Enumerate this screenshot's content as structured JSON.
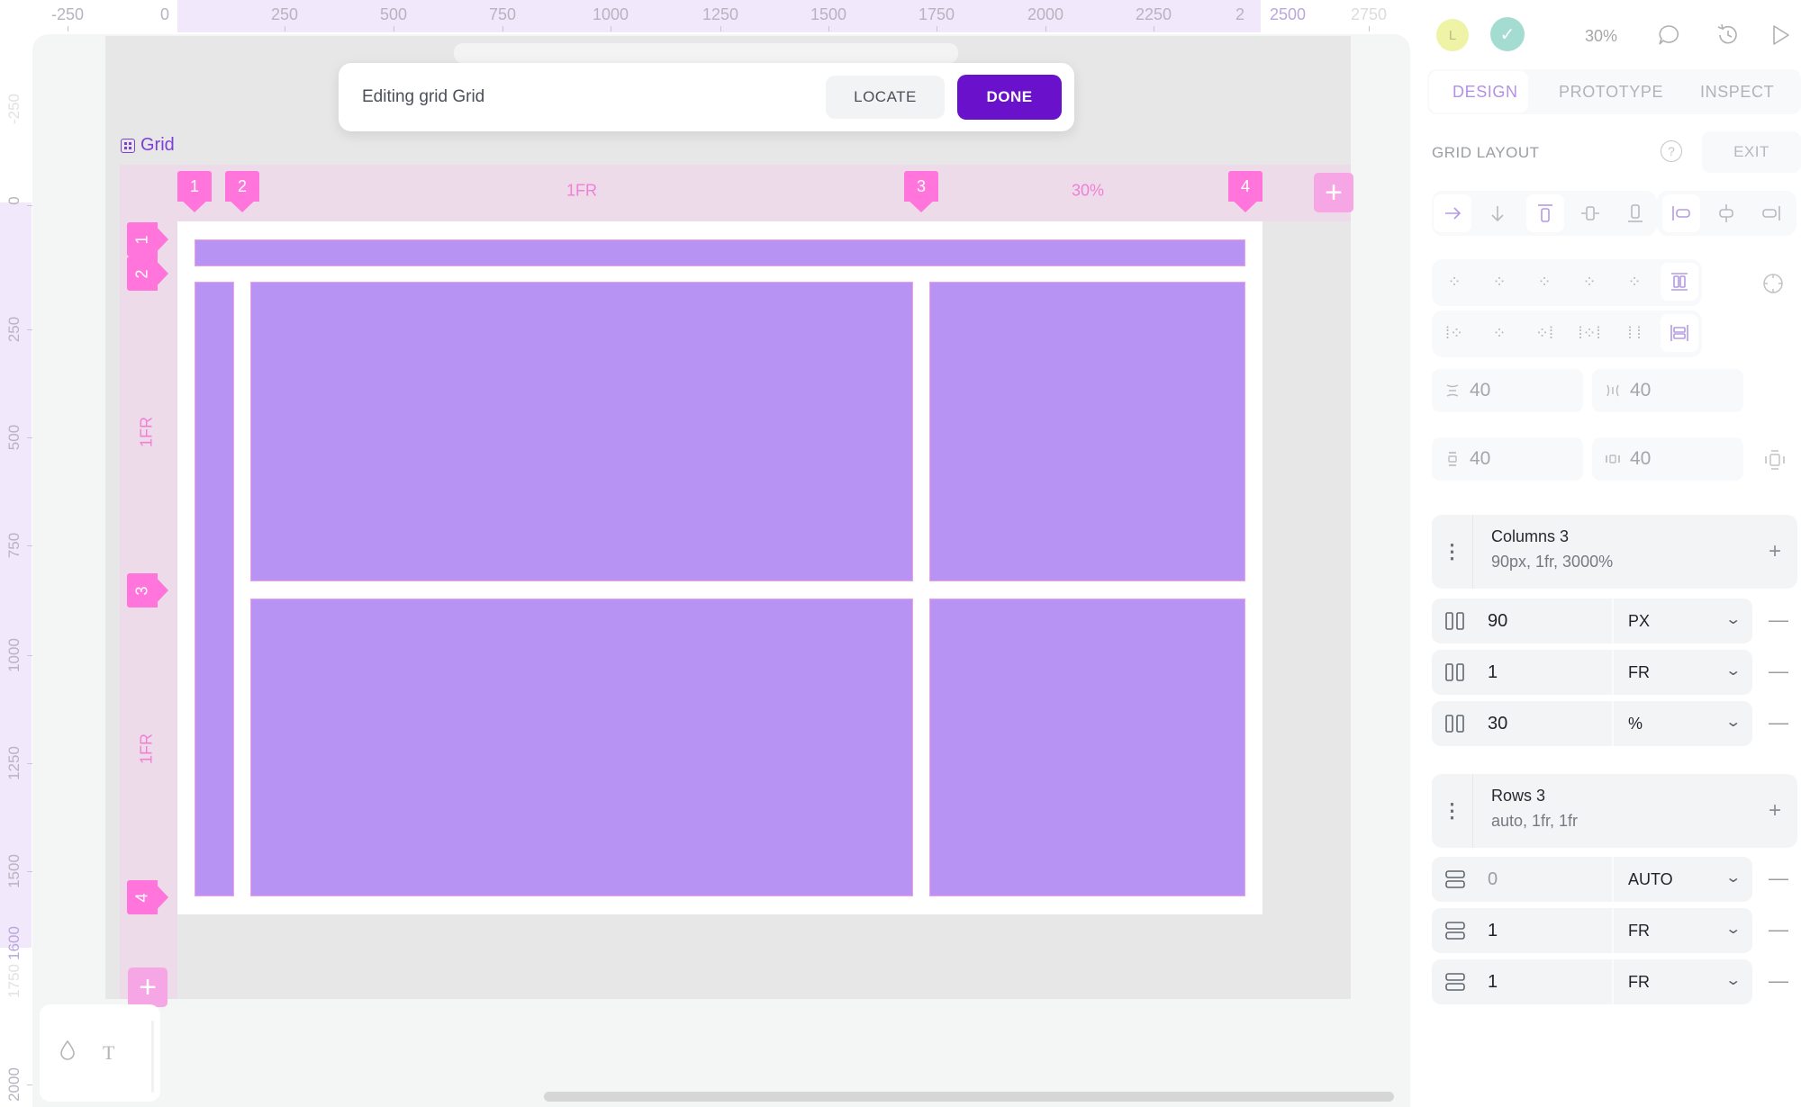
{
  "ruler_top": {
    "labels": [
      "-250",
      "0",
      "250",
      "500",
      "750",
      "1000",
      "1250",
      "1500",
      "1750",
      "2000",
      "2250",
      "2",
      "2500",
      "2750"
    ]
  },
  "ruler_left": {
    "labels": [
      "-250",
      "0",
      "250",
      "500",
      "750",
      "1000",
      "1250",
      "1500",
      "1600",
      "1750",
      "2000"
    ]
  },
  "edit_toolbar": {
    "title": "Editing grid Grid",
    "locate_label": "LOCATE",
    "done_label": "DONE"
  },
  "canvas": {
    "board_name": "Grid",
    "column_markers": [
      "1",
      "2",
      "3",
      "4"
    ],
    "row_markers": [
      "1",
      "2",
      "3",
      "4"
    ],
    "column_sizes": [
      "1FR",
      "30%"
    ],
    "row_sizes": [
      "1FR",
      "1FR"
    ],
    "add_column_icon": "plus-icon",
    "add_row_icon": "plus-icon",
    "cell_color": "#b794f4",
    "marker_color": "#ff75dc"
  },
  "tools": {
    "fill_icon": "drop-icon",
    "text_icon": "T"
  },
  "header": {
    "avatar_initial": "L",
    "status_icon": "check-icon",
    "zoom": "30%"
  },
  "tabs": [
    {
      "label": "DESIGN",
      "active": true
    },
    {
      "label": "PROTOTYPE",
      "active": false
    },
    {
      "label": "INSPECT",
      "active": false
    }
  ],
  "grid_layout": {
    "title": "GRID LAYOUT",
    "exit_label": "EXIT",
    "direction": "row",
    "gaps": {
      "row_gap": "40",
      "column_gap": "40",
      "padding_vertical": "40",
      "padding_horizontal": "40"
    },
    "columns": {
      "name": "Columns 3",
      "summary": "90px, 1fr, 3000%",
      "tracks": [
        {
          "value": "90",
          "unit": "PX"
        },
        {
          "value": "1",
          "unit": "FR"
        },
        {
          "value": "30",
          "unit": "%"
        }
      ]
    },
    "rows": {
      "name": "Rows 3",
      "summary": "auto, 1fr, 1fr",
      "tracks": [
        {
          "value": "0",
          "unit": "AUTO"
        },
        {
          "value": "1",
          "unit": "FR"
        },
        {
          "value": "1",
          "unit": "FR"
        }
      ]
    }
  }
}
